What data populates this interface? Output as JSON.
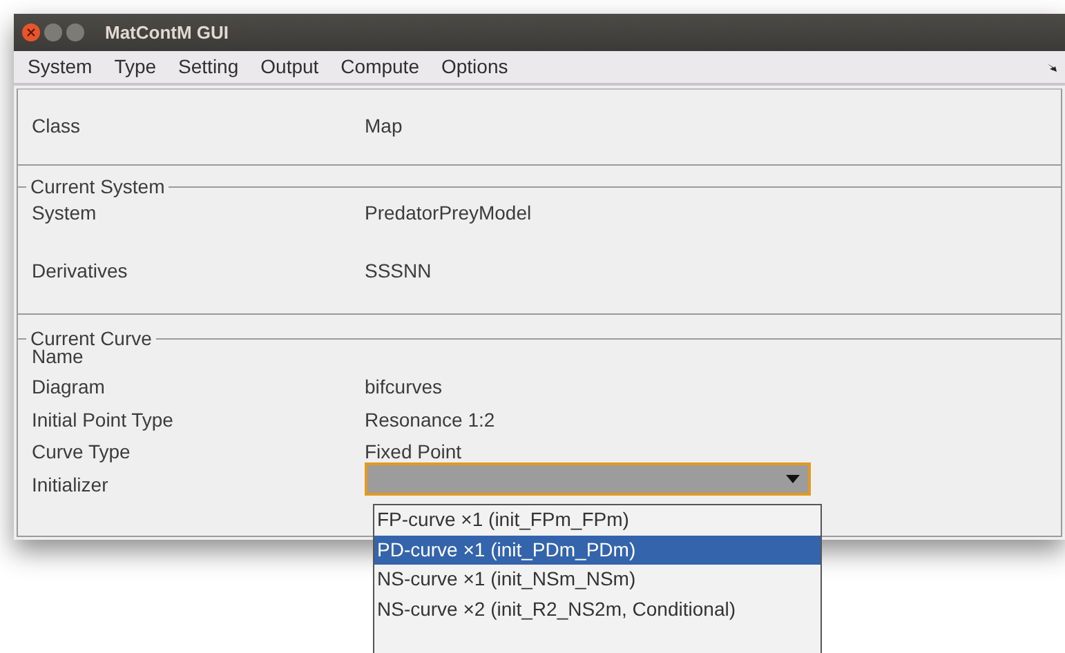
{
  "window": {
    "title": "MatContM GUI"
  },
  "menu": [
    {
      "label": "System"
    },
    {
      "label": "Type"
    },
    {
      "label": "Setting"
    },
    {
      "label": "Output"
    },
    {
      "label": "Compute"
    },
    {
      "label": "Options"
    }
  ],
  "class_row": {
    "label": "Class",
    "value": "Map"
  },
  "current_system": {
    "title": "Current System",
    "rows": [
      {
        "label": "System",
        "value": "PredatorPreyModel"
      },
      {
        "label": "Derivatives",
        "value": "SSSNN"
      }
    ]
  },
  "current_curve": {
    "title": "Current Curve",
    "rows": [
      {
        "label": "Name"
      },
      {
        "label": "Diagram",
        "value": "bifcurves"
      },
      {
        "label": "Initial Point Type",
        "value": "Resonance 1:2"
      },
      {
        "label": "Curve Type",
        "value": "Fixed Point"
      }
    ]
  },
  "initializer": {
    "label": "Initializer",
    "expanded": true,
    "options": [
      {
        "label": "FP-curve ×1 (init_FPm_FPm)",
        "selected": false
      },
      {
        "label": "PD-curve ×1 (init_PDm_PDm)",
        "selected": true
      },
      {
        "label": "NS-curve ×1 (init_NSm_NSm)",
        "selected": false
      },
      {
        "label": "NS-curve ×2 (init_R2_NS2m, Conditional)",
        "selected": false
      }
    ]
  }
}
